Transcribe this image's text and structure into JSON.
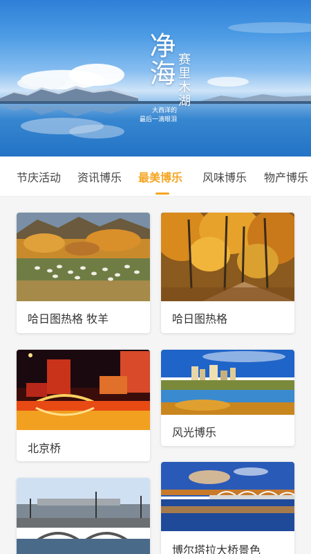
{
  "banner": {
    "title": "净海",
    "subtitle": "赛里木湖",
    "caption_line1": "大西洋的",
    "caption_line2": "最后一滴眼泪"
  },
  "tabs": [
    {
      "label": "节庆活动",
      "active": false
    },
    {
      "label": "资讯博乐",
      "active": false
    },
    {
      "label": "最美博乐",
      "active": true
    },
    {
      "label": "风味博乐",
      "active": false
    },
    {
      "label": "物产博乐",
      "active": false
    }
  ],
  "colors": {
    "accent": "#f5a623",
    "text": "#333333",
    "background": "#f5f5f5",
    "card": "#ffffff"
  },
  "cards": [
    {
      "label": "哈日图热格 牧羊"
    },
    {
      "label": "哈日图热格"
    },
    {
      "label": "北京桥"
    },
    {
      "label": "风光博乐"
    },
    {
      "label": ""
    },
    {
      "label": "博尔塔拉大桥景色"
    }
  ]
}
